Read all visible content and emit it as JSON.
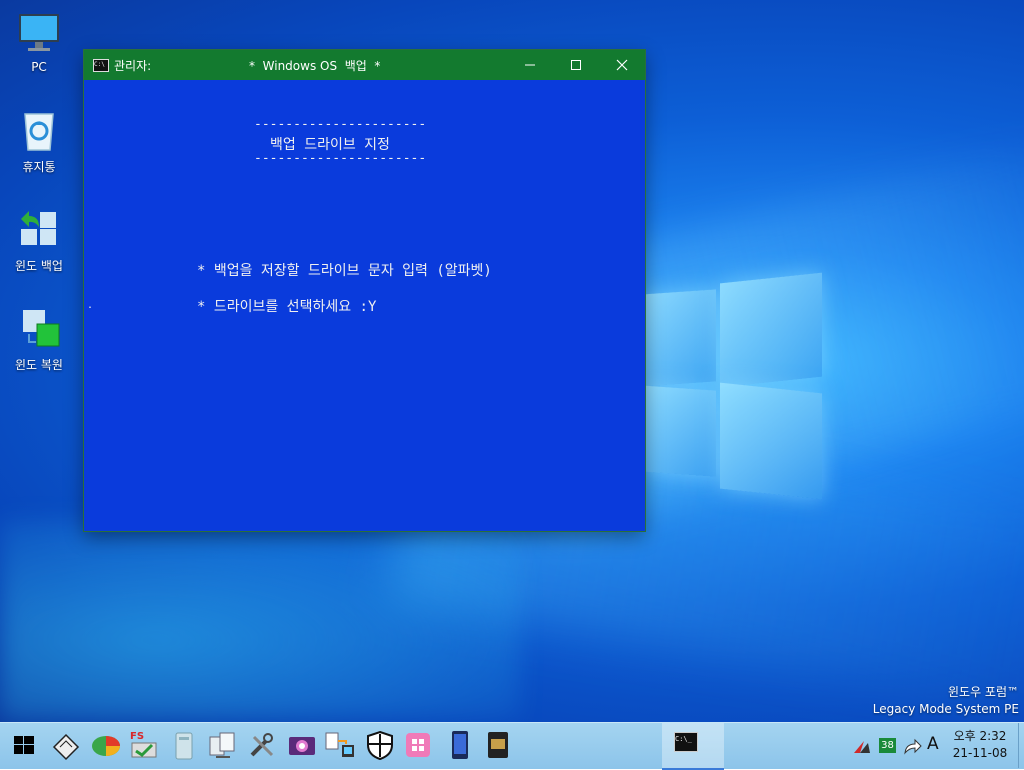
{
  "desktop": {
    "icons": [
      {
        "label": "PC",
        "icon": "computer-icon"
      },
      {
        "label": "휴지통",
        "icon": "recycle-bin-icon"
      },
      {
        "label": "윈도 백업",
        "icon": "backup-icon"
      },
      {
        "label": "윈도 복원",
        "icon": "restore-icon"
      }
    ],
    "watermark": {
      "line1": "윈도우 포럼™",
      "line2": "Legacy Mode System PE"
    }
  },
  "window": {
    "admin_label": "관리자:",
    "title": "*  Windows OS  백업  *",
    "console": {
      "separator_top": "----------------------",
      "header": "백업 드라이브 지정",
      "separator_bottom": "----------------------",
      "prompt1": "* 백업을 저장할 드라이브 문자 입력 (알파벳)",
      "prompt2": "* 드라이브를 선택하세요 :Y",
      "cursor": "."
    },
    "colors": {
      "titlebar": "#137a2f",
      "console_bg": "#0a3bdc",
      "console_fg": "#f0f0f0"
    }
  },
  "taskbar": {
    "start_icon": "windows-start-icon",
    "pinned": [
      "disk-tool-icon",
      "partition-tool-icon",
      "fs-copy-icon",
      "backup-drive-icon",
      "network-tool-icon",
      "tools-icon",
      "image-viewer-icon",
      "file-transfer-icon",
      "shield-icon",
      "app-store-icon",
      "phone-icon",
      "memory-card-icon"
    ],
    "active_window_icon": "command-prompt-icon",
    "tray": {
      "icons": [
        "antivirus-icon",
        "temperature-icon",
        "share-icon",
        "input-method-icon"
      ],
      "temperature": "38",
      "input_method": "A",
      "time": "오후 2:32",
      "date": "21-11-08"
    }
  }
}
